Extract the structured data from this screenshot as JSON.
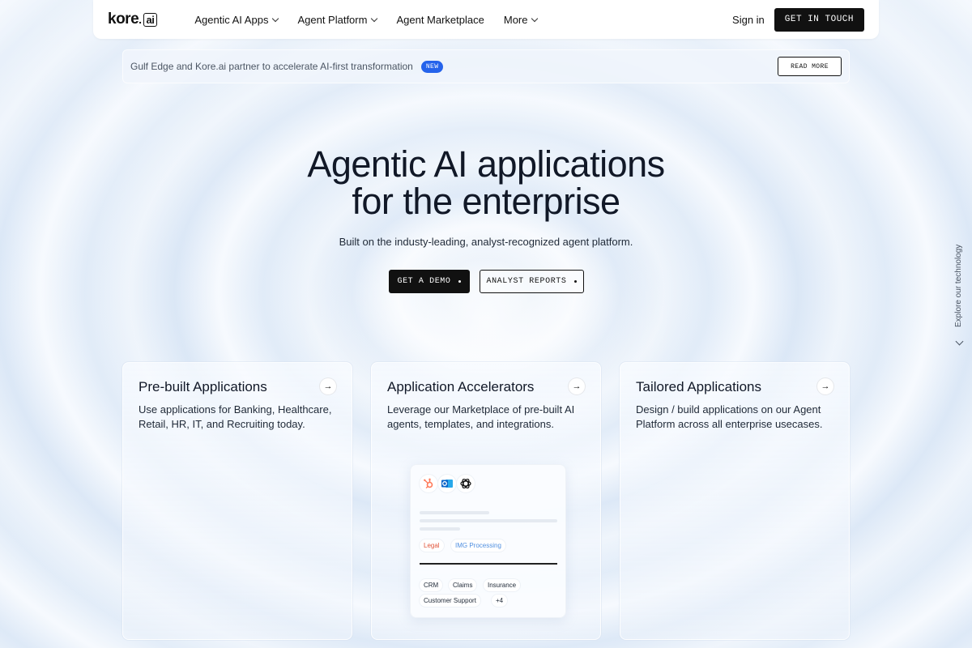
{
  "nav": {
    "logo_text": "kore",
    "logo_suffix": "ai",
    "menu": [
      {
        "label": "Agentic AI Apps",
        "has_dropdown": true
      },
      {
        "label": "Agent Platform",
        "has_dropdown": true
      },
      {
        "label": "Agent Marketplace",
        "has_dropdown": false
      },
      {
        "label": "More",
        "has_dropdown": true
      }
    ],
    "sign_in": "Sign in",
    "cta": "GET IN TOUCH"
  },
  "banner": {
    "text": "Gulf Edge and Kore.ai partner to accelerate AI-first transformation",
    "badge": "NEW",
    "button": "READ MORE"
  },
  "hero": {
    "title_line1": "Agentic AI applications",
    "title_line2": "for the enterprise",
    "subtitle": "Built on the industy-leading, analyst-recognized agent platform.",
    "primary_cta": "GET A DEMO",
    "secondary_cta": "ANALYST REPORTS"
  },
  "side": {
    "explore": "Explore our technology"
  },
  "cards": [
    {
      "title": "Pre-built Applications",
      "body": "Use applications for Banking, Healthcare, Retail, HR, IT, and Recruiting today."
    },
    {
      "title": "Application Accelerators",
      "body": "Leverage our Marketplace of pre-built AI agents, templates, and integrations."
    },
    {
      "title": "Tailored Applications",
      "body": "Design / build applications on our Agent Platform across all enterprise usecases."
    }
  ],
  "mockup": {
    "icons": [
      "hubspot-icon",
      "outlook-icon",
      "openai-icon"
    ],
    "tags": [
      "Legal",
      "IMG Processing"
    ],
    "chips": [
      "CRM",
      "Claims",
      "Insurance",
      "Customer Support",
      "+4"
    ]
  },
  "colors": {
    "dark": "#111111",
    "badge_blue": "#2563eb",
    "legal_tag": "#e2563b",
    "img_tag": "#4f8fe0",
    "hubspot": "#ff7a59",
    "outlook": "#0a64c9"
  }
}
